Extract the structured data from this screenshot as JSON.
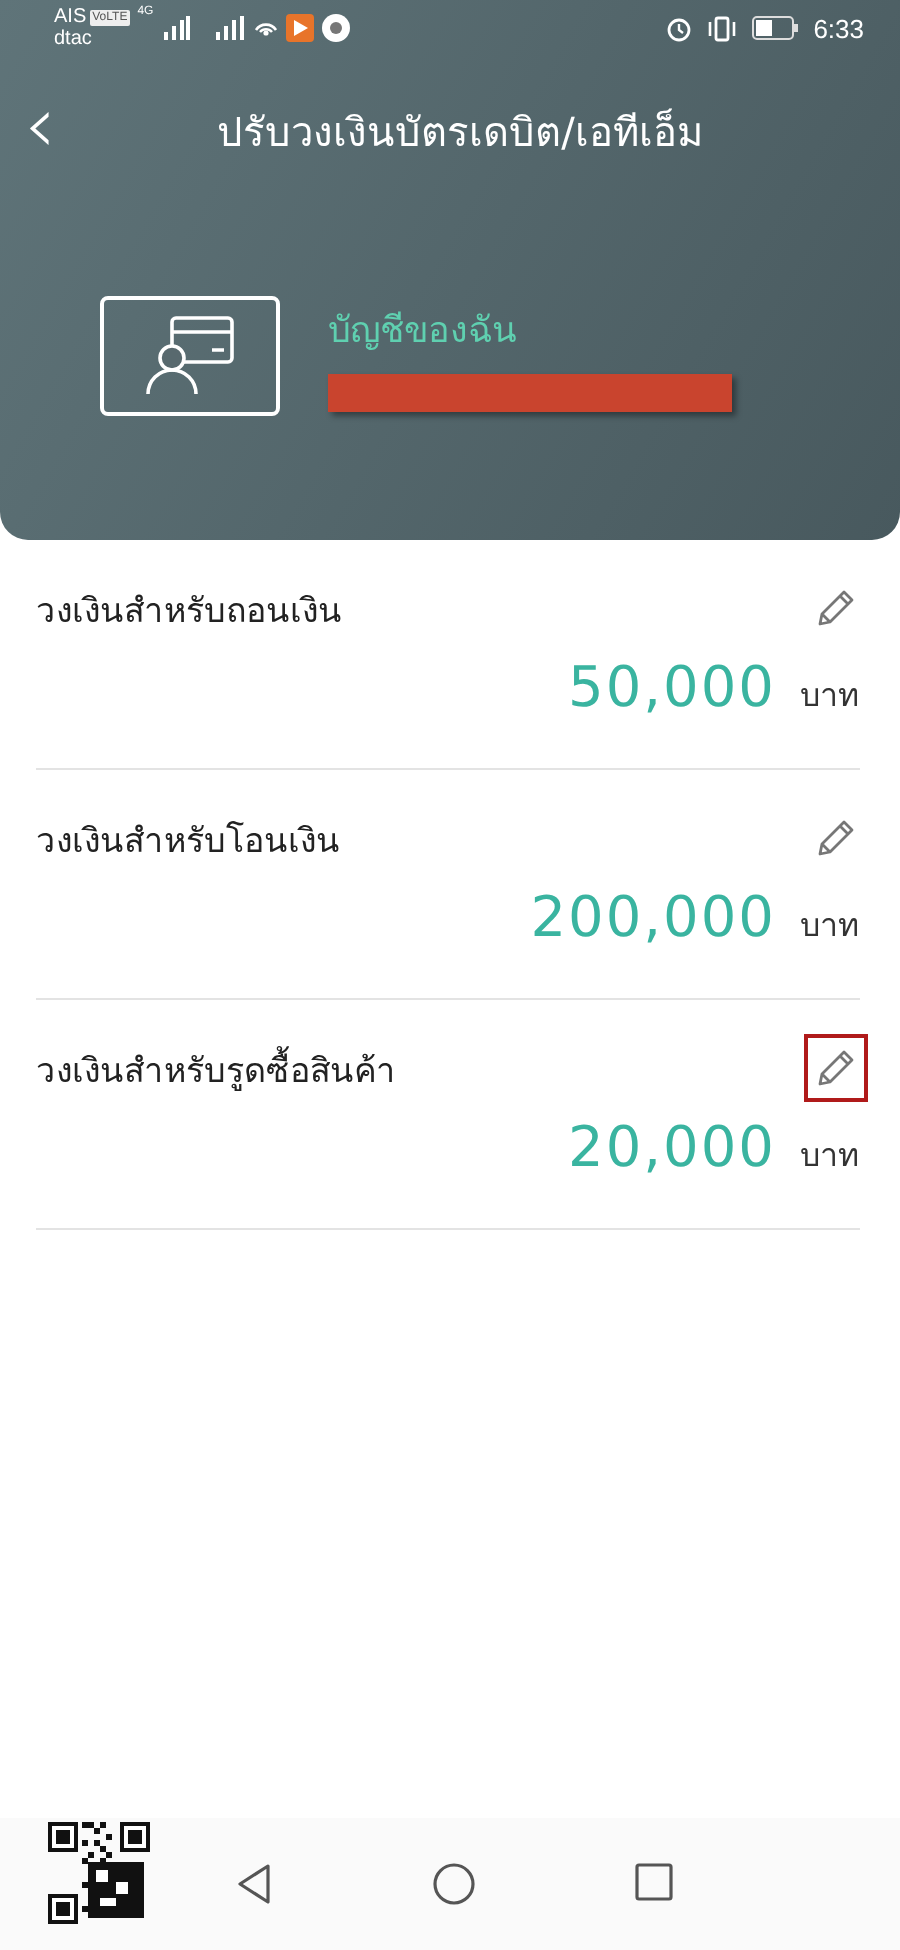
{
  "status_bar": {
    "carrier_1": "AIS",
    "volte_badge": "VoLTE",
    "network_type": "4G",
    "carrier_2": "dtac",
    "time": "6:33"
  },
  "header": {
    "back_icon": "‹",
    "title": "ปรับวงเงินบัตรเดบิต/เอทีเอ็ม",
    "account_label": "บัญชีของฉัน",
    "account_number_redacted": true
  },
  "limits": [
    {
      "label": "วงเงินสำหรับถอนเงิน",
      "amount": "50,000",
      "unit": "บาท",
      "highlighted": false
    },
    {
      "label": "วงเงินสำหรับโอนเงิน",
      "amount": "200,000",
      "unit": "บาท",
      "highlighted": false
    },
    {
      "label": "วงเงินสำหรับรูดซื้อสินค้า",
      "amount": "20,000",
      "unit": "บาท",
      "highlighted": true
    }
  ]
}
